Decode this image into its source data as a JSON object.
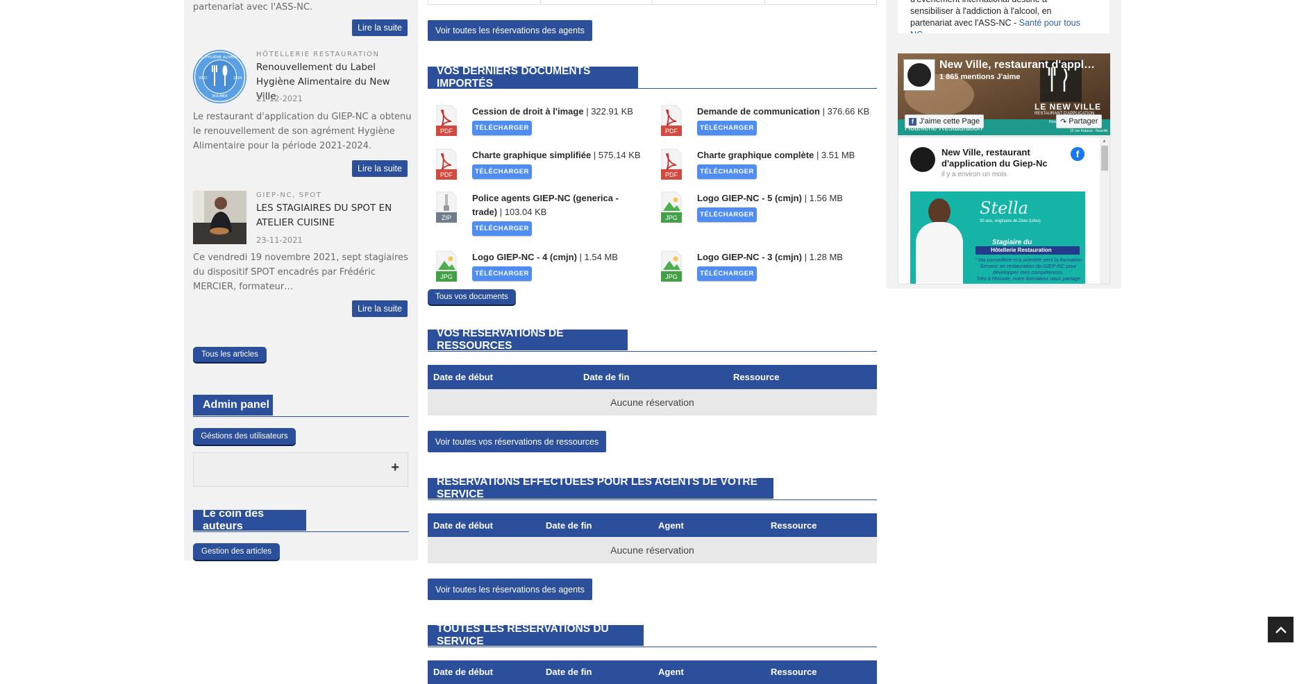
{
  "left": {
    "intro_tail": "partenariat avec l'ASS-NC.",
    "read_more": "Lire la suite",
    "articles": [
      {
        "category": "HÔTELLERIE RESTAURATION",
        "title": "Renouvellement du Label Hygiène Alimentaire du New Ville",
        "date": "21-12-2021",
        "excerpt": "Le restaurant d'application du GIEP-NC a obtenu le renouvellement de son agrément Hygiène Alimentaire pour la période 2021-2024."
      },
      {
        "category": "GIEP-NC, SPOT",
        "title": "LES STAGIAIRES DU SPOT EN ATELIER CUISINE",
        "date": "23-11-2021",
        "excerpt": "Ce vendredi 19 novembre 2021, sept stagiaires du dispositif SPOT encadrés par Frédéric MERCIER, formateur…"
      }
    ],
    "all_articles": "Tous les articles",
    "admin_title": "Admin panel",
    "admin_button": "Géstions des utilisateurs",
    "plus": "+",
    "authors_title": "Le coin des auteurs",
    "authors_button": "Gestion des articles",
    "badge_top": "LABEL HYGIÈNE ALIMENTAIRE",
    "badge_years_left": "2021",
    "badge_years_right": "2024",
    "badge_bottom": "NOUMÉA"
  },
  "center": {
    "see_all_agents_top": "Voir toutes les réservations des agents",
    "docs_title": "VOS DERNIERS DOCUMENTS IMPORTÉS",
    "download": "TÉLÉCHARGER",
    "documents": [
      {
        "name": "Cession de droit à l'image",
        "size": "| 322.91 KB",
        "type": "PDF"
      },
      {
        "name": "Demande de communication",
        "size": "| 376.66 KB",
        "type": "PDF"
      },
      {
        "name": "Charte graphique simplifiée",
        "size": "| 575.14 KB",
        "type": "PDF"
      },
      {
        "name": "Charte graphique complète",
        "size": "| 3.51 MB",
        "type": "PDF"
      },
      {
        "name": "Police agents GIEP-NC (generica - trade)",
        "size": "| 103.04 KB",
        "type": "ZIP"
      },
      {
        "name": "Logo GIEP-NC - 5 (cmjn)",
        "size": "| 1.56 MB",
        "type": "JPG"
      },
      {
        "name": "Logo GIEP-NC - 4 (cmjn)",
        "size": "| 1.54 MB",
        "type": "JPG"
      },
      {
        "name": "Logo GIEP-NC - 3 (cmjn)",
        "size": "| 1.28 MB",
        "type": "JPG"
      }
    ],
    "all_docs": "Tous vos documents",
    "res_title": "VOS RÉSERVATIONS DE RESSOURCES",
    "res_cols": [
      "Date de début",
      "Date de fin",
      "Ressource"
    ],
    "no_res": "Aucune réservation",
    "see_res": "Voir toutes vos réservations de ressources",
    "agents_title": "RÉSERVATIONS EFFECTUÉES POUR LES AGENTS DE VOTRE SERVICE",
    "agents_cols": [
      "Date de début",
      "Date de fin",
      "Agent",
      "Ressource"
    ],
    "see_agents": "Voir toutes les réservations des agents",
    "service_title": "TOUTES LES RÉSERVATIONS DU SERVICE",
    "service_cols": [
      "Date de début",
      "Date de fin",
      "Agent",
      "Ressource"
    ]
  },
  "right": {
    "top_text_1": "d'événement international destiné à",
    "top_text_2": "sensibiliser à l'addiction à l'alcool, en",
    "top_text_3": "partenariat avec l'ASS-NC -",
    "top_link": "Santé pour tous",
    "top_text_4": "NC",
    "fb_page": "New Ville, restaurant d'appl…",
    "fb_likes": "1 865 mentions J'aime",
    "fb_like_btn": "J'aime cette Page",
    "fb_share_btn": "Partager",
    "cover_brand": "LE NEW VILLE",
    "cover_sub": "RESTAURANT D'APPLICATION",
    "cover_bottom": "Hôtellerie Restauration",
    "cover_info": "Réservez au 86..",
    "cover_addr": "10 rue Kataoui - Nouville",
    "post_author": "New Ville, restaurant d'application du Giep-Nc",
    "post_time": "il y a environ un mois",
    "post_name": "Stella",
    "post_sub": "30 ans, originaire de Ziste (Lifou)",
    "post_stag": "Stagiaire du",
    "post_stag2": "Hôtellerie Restauration",
    "post_quote_1": "\" Ma conseillère m'a orientée vers la formation",
    "post_quote_2": "Serveur en restauration du GIEP-NC pour",
    "post_quote_3": "développer mes compétences.",
    "post_quote_4": "Très à l'écoute, notre formateur nous partage"
  },
  "colors": {
    "primary": "#2b4f9b",
    "download": "#4f8ef0",
    "pdf": "#c9302c",
    "sidebar_bg": "#f2f2f2"
  }
}
